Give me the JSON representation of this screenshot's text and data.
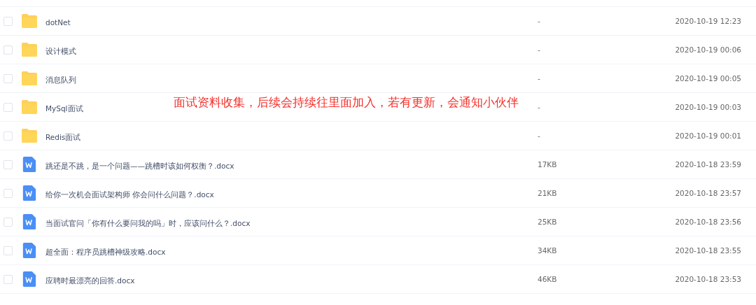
{
  "files": [
    {
      "kind": "folder",
      "name": "dotNet",
      "size": "-",
      "modified": "2020-10-19 12:23",
      "checked": false
    },
    {
      "kind": "folder",
      "name": "设计模式",
      "size": "-",
      "modified": "2020-10-19 00:06",
      "checked": false
    },
    {
      "kind": "folder",
      "name": "消息队列",
      "size": "-",
      "modified": "2020-10-19 00:05",
      "checked": false
    },
    {
      "kind": "folder",
      "name": "MySql面试",
      "size": "-",
      "modified": "2020-10-19 00:03",
      "checked": false
    },
    {
      "kind": "folder",
      "name": "Redis面试",
      "size": "-",
      "modified": "2020-10-19 00:01",
      "checked": false
    },
    {
      "kind": "word",
      "name": "跳还是不跳，是一个问题——跳槽时该如何权衡？.docx",
      "size": "17KB",
      "modified": "2020-10-18 23:59",
      "checked": false
    },
    {
      "kind": "word",
      "name": "给你一次机会面试架构师 你会问什么问题？.docx",
      "size": "21KB",
      "modified": "2020-10-18 23:57",
      "checked": false
    },
    {
      "kind": "word",
      "name": "当面试官问「你有什么要问我的吗」时，应该问什么？.docx",
      "size": "25KB",
      "modified": "2020-10-18 23:56",
      "checked": false
    },
    {
      "kind": "word",
      "name": "超全面：程序员跳槽神级攻略.docx",
      "size": "34KB",
      "modified": "2020-10-18 23:55",
      "checked": false
    },
    {
      "kind": "word",
      "name": "应聘时最漂亮的回答.docx",
      "size": "46KB",
      "modified": "2020-10-18 23:53",
      "checked": false
    }
  ],
  "annotation": "面试资料收集，后续会持续往里面加入，若有更新，会通知小伙伴"
}
